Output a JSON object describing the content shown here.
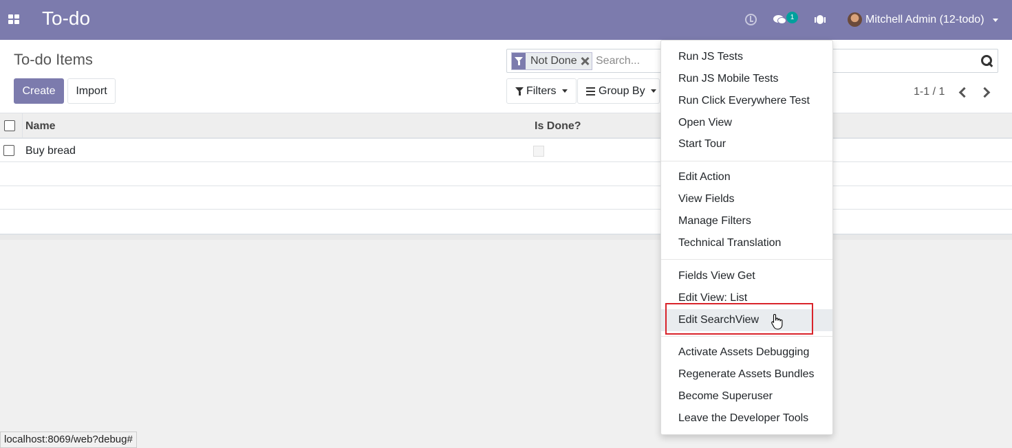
{
  "navbar": {
    "app_title": "To-do",
    "message_count": "1",
    "user_name": "Mitchell Admin (12-todo)",
    "icons": [
      "apps-icon",
      "clock-icon",
      "chat-icon",
      "bug-icon",
      "avatar"
    ]
  },
  "control": {
    "breadcrumb": "To-do Items",
    "create_label": "Create",
    "import_label": "Import",
    "facet_label": "Not Done",
    "search_placeholder": "Search...",
    "filters_label": "Filters",
    "groupby_label": "Group By",
    "pager_value": "1-1 / 1"
  },
  "list": {
    "columns": [
      "Name",
      "Is Done?"
    ],
    "rows": [
      {
        "name": "Buy bread",
        "is_done": false
      }
    ]
  },
  "dropdown": {
    "items": [
      "Run JS Tests",
      "Run JS Mobile Tests",
      "Run Click Everywhere Test",
      "Open View",
      "Start Tour",
      "Edit Action",
      "View Fields",
      "Manage Filters",
      "Technical Translation",
      "Fields View Get",
      "Edit View: List",
      "Edit SearchView",
      "Activate Assets Debugging",
      "Regenerate Assets Bundles",
      "Become Superuser",
      "Leave the Developer Tools"
    ],
    "active_item": "Edit SearchView"
  },
  "status_url": "localhost:8069/web?debug#",
  "colors": {
    "brand": "#7c7bad",
    "badge": "#00a09d",
    "highlight": "#d9232a"
  }
}
